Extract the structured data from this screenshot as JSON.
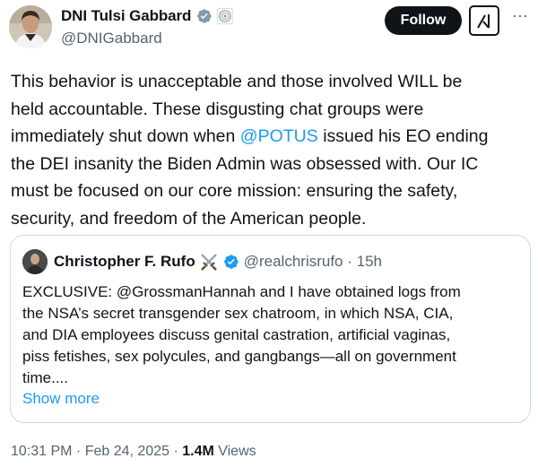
{
  "author": {
    "display_name": "DNI Tulsi Gabbard",
    "handle": "@DNIGabbard"
  },
  "actions": {
    "follow_label": "Follow",
    "grok_icon": "grok-icon",
    "more_label": "···"
  },
  "tweet": {
    "lines": [
      "This behavior is unacceptable and those involved WILL be",
      "held accountable. These disgusting chat groups were",
      "the DEI insanity the Biden Admin was obsessed with. Our IC",
      "must be focused on our core mission: ensuring the safety,",
      "security, and freedom of the American people."
    ],
    "line3_before": "immediately shut down when ",
    "mention": "@POTUS",
    "line3_after": " issued his EO ending"
  },
  "quote": {
    "display_name": "Christopher F. Rufo",
    "handle_time": "@realchrisrufo · 15h",
    "lines": [
      "EXCLUSIVE: @GrossmanHannah and I have obtained logs from",
      "the NSA’s secret transgender sex chatroom, in which NSA, CIA,",
      "and DIA employees discuss genital castration, artificial vaginas,",
      "piss fetishes, sex polycules, and gangbangs—all on government",
      "time...."
    ],
    "show_more": "Show more"
  },
  "meta": {
    "timestamp": "10:31 PM · Feb 24, 2025 · ",
    "views_count": "1.4M",
    "views_label": " Views"
  },
  "colors": {
    "link": "#1d9bf0",
    "secondary_text": "#536471",
    "verified_gray": "#829aab",
    "verified_blue": "#1d9bf0"
  }
}
